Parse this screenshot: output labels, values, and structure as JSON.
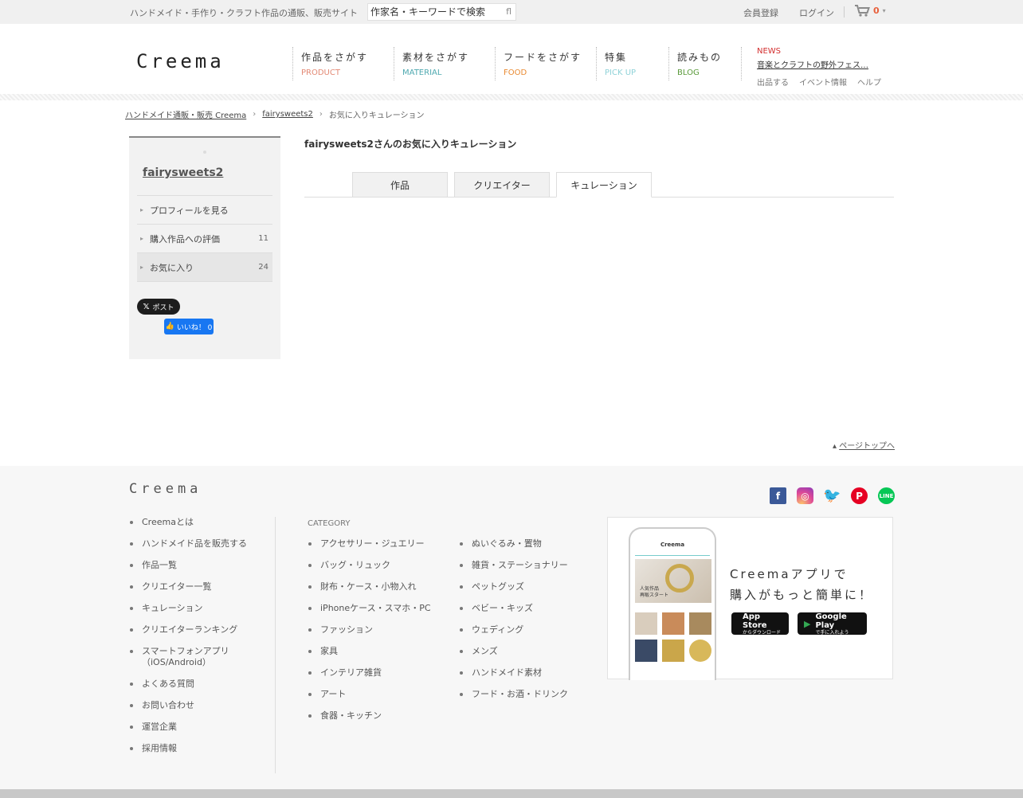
{
  "topbar": {
    "tagline": "ハンドメイド・手作り・クラフト作品の通販、販売サイト",
    "search_placeholder": "作家名・キーワードで検索",
    "search_button": "fl",
    "register": "会員登録",
    "login": "ログイン",
    "cart_count": "0"
  },
  "header": {
    "logo": "Creema",
    "nav": [
      {
        "label": "作品をさがす",
        "sub": "PRODUCT",
        "color": "#e38a75"
      },
      {
        "label": "素材をさがす",
        "sub": "MATERIAL",
        "color": "#4fa9b0"
      },
      {
        "label": "フードをさがす",
        "sub": "FOOD",
        "color": "#e98a32"
      },
      {
        "label": "特集",
        "sub": "PICK UP",
        "color": "#8fd2d8"
      },
      {
        "label": "読みもの",
        "sub": "BLOG",
        "color": "#5a9a3a"
      }
    ],
    "news_label": "NEWS",
    "news_link": "音楽とクラフトの野外フェス…",
    "subnav": [
      "出品する",
      "イベント情報",
      "ヘルプ"
    ]
  },
  "breadcrumb": [
    "ハンドメイド通販・販売 Creema",
    "fairysweets2",
    "お気に入りキュレーション"
  ],
  "sidebar": {
    "username": "fairysweets2",
    "items": [
      {
        "label": "プロフィールを見る",
        "count": ""
      },
      {
        "label": "購入作品への評価",
        "count": "11"
      },
      {
        "label": "お気に入り",
        "count": "24"
      }
    ],
    "tweet": "ポスト",
    "like": "いいね！ 0"
  },
  "main": {
    "title": "fairysweets2さんのお気に入りキュレーション",
    "tabs": [
      "作品",
      "クリエイター",
      "キュレーション"
    ],
    "active_tab": 2,
    "pagetop": "ページトップへ"
  },
  "footer": {
    "logo": "Creema",
    "links": [
      "Creemaとは",
      "ハンドメイド品を販売する",
      "作品一覧",
      "クリエイター一覧",
      "キュレーション",
      "クリエイターランキング",
      "スマートフォンアプリ（iOS/Android）",
      "よくある質問",
      "お問い合わせ",
      "運営企業",
      "採用情報"
    ],
    "category_label": "CATEGORY",
    "categories_left": [
      "アクセサリー・ジュエリー",
      "バッグ・リュック",
      "財布・ケース・小物入れ",
      "iPhoneケース・スマホ・PC",
      "ファッション",
      "家具",
      "インテリア雑貨",
      "アート",
      "食器・キッチン"
    ],
    "categories_right": [
      "ぬいぐるみ・置物",
      "雑貨・ステーショナリー",
      "ペットグッズ",
      "ベビー・キッズ",
      "ウェディング",
      "メンズ",
      "ハンドメイド素材",
      "フード・お酒・ドリンク"
    ],
    "app_copy_line1": "Creemaアプリで",
    "app_copy_line2": "購入がもっと簡単に！",
    "app_store_big": "App Store",
    "app_store_small": "からダウンロード",
    "google_play_big": "Google Play",
    "google_play_small": "で手に入れよう",
    "phone_logo": "Creema",
    "phone_hero_text": "人気作品\n再販スタート"
  }
}
